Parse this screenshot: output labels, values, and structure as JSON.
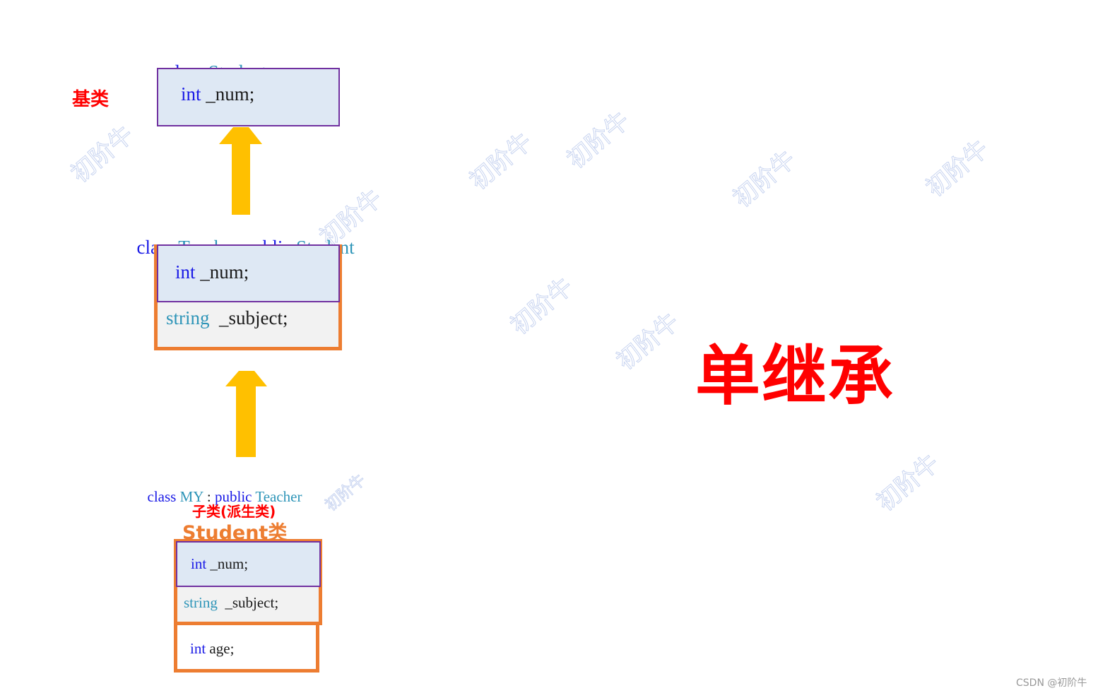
{
  "watermarks": [
    "初阶牛",
    "初阶牛",
    "初阶牛",
    "初阶牛",
    "初阶牛",
    "初阶牛",
    "初阶牛",
    "初阶牛",
    "初阶牛",
    "初阶牛"
  ],
  "base": {
    "label": "基类",
    "header": {
      "kw": "class",
      "name": "Student"
    },
    "members": [
      {
        "type": "int",
        "name": " _num;"
      }
    ]
  },
  "teacher": {
    "header": {
      "kw": "class",
      "name": "Teacher",
      "colon": ":",
      "access": "public",
      "base": "Student"
    },
    "members": [
      {
        "type": "int",
        "name": " _num;"
      },
      {
        "type": "string",
        "name": "  _subject;"
      }
    ]
  },
  "derived": {
    "header": {
      "kw": "class",
      "name": "MY",
      "colon": " : ",
      "access": "public",
      "base": "Teacher"
    },
    "label": "子类(派生类)",
    "sublabel": "Student类",
    "members": [
      {
        "type": "int",
        "name": " _num;"
      },
      {
        "type": "string",
        "name": "  _subject;"
      },
      {
        "type": "int",
        "name": " age;"
      }
    ]
  },
  "title": "单继承",
  "footer": "CSDN @初阶牛",
  "colors": {
    "keyword": "#1a1ae6",
    "type": "#2e95b8",
    "purple_border": "#7030a0",
    "orange_border": "#ed7d31",
    "arrow": "#ffc000",
    "label_red": "#ff0000"
  }
}
